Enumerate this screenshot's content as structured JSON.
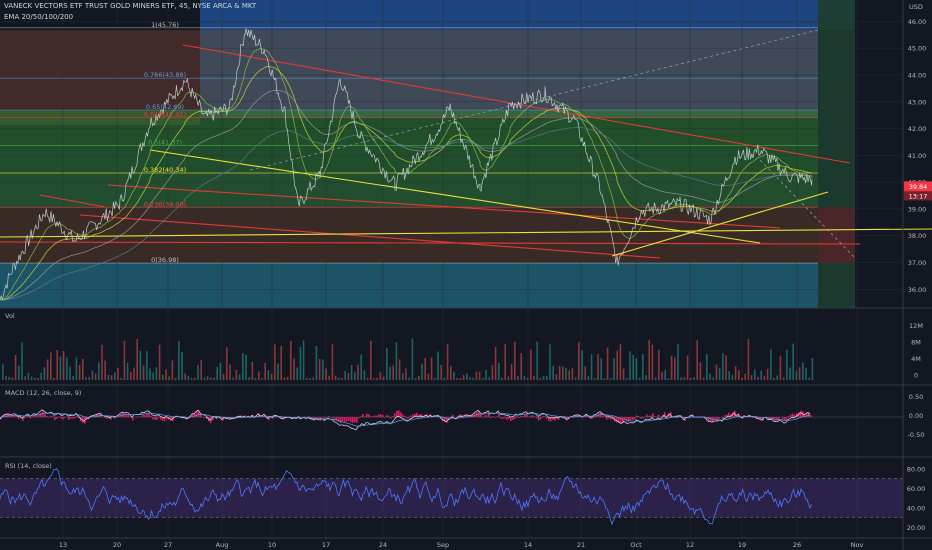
{
  "header": {
    "title": "VANECK VECTORS ETF TRUST GOLD MINERS ETF, 45, NYSE ARCA & MKT",
    "indicator": "EMA 20/50/100/200"
  },
  "panes": {
    "vol_label": "Vol",
    "macd_label": "MACD (12, 26, close, 9)",
    "rsi_label": "RSI (14, close)"
  },
  "price_scale": {
    "currency": "USD",
    "ticks": [
      "46.00",
      "45.00",
      "44.00",
      "43.00",
      "42.00",
      "41.00",
      "40.00",
      "39.00",
      "38.00",
      "37.00",
      "36.00"
    ],
    "last_price": "39.84",
    "countdown": "13:17",
    "last_color": "#f23645"
  },
  "vol_scale": {
    "ticks": [
      "12M",
      "8M",
      "4M",
      "0"
    ]
  },
  "macd_scale": {
    "ticks": [
      "0.50",
      "0.00",
      "-0.50"
    ]
  },
  "rsi_scale": {
    "ticks": [
      "80.00",
      "60.00",
      "40.00",
      "20.00"
    ]
  },
  "x_axis": {
    "ticks": [
      "13",
      "20",
      "27",
      "Aug",
      "10",
      "17",
      "24",
      "Sep",
      "14",
      "21",
      "Oct",
      "12",
      "19",
      "26",
      "Nov"
    ]
  },
  "fib_labels": [
    "1(45.76)",
    "0.786(43.88)",
    "0.65(42.69)",
    "0.618(42.41)",
    "0.5(41.37)",
    "0.382(40.34)",
    "0.236(39.06)",
    "0(36.98)"
  ],
  "colors": {
    "bg": "#131722",
    "up": "#4caf50",
    "down": "#f23645",
    "fib_green": "#2e7d32",
    "fib_blue": "#1565c0",
    "trend_yellow": "#e8e23a",
    "trend_red": "#e53935",
    "macd_line": "#2962ff",
    "signal": "#ff6d00",
    "hist": "#ff1f6a",
    "rsi": "#4e79ff"
  },
  "chart_data": {
    "type": "line",
    "title": "VANECK VECTORS ETF TRUST GOLD MINERS ETF, 45, NYSE ARCA & MKT",
    "x_ticks": [
      "13",
      "20",
      "27",
      "Aug",
      "10",
      "17",
      "24",
      "Sep",
      "14",
      "21",
      "Oct",
      "12",
      "19",
      "26",
      "Nov"
    ],
    "y_range": [
      35.3,
      46.5
    ],
    "price_path": [
      [
        0,
        35.6
      ],
      [
        13,
        36.8
      ],
      [
        45,
        38.9
      ],
      [
        75,
        37.8
      ],
      [
        120,
        39.2
      ],
      [
        150,
        42.2
      ],
      [
        185,
        43.8
      ],
      [
        205,
        42.4
      ],
      [
        230,
        42.8
      ],
      [
        245,
        45.7
      ],
      [
        265,
        44.9
      ],
      [
        285,
        42.6
      ],
      [
        298,
        39.1
      ],
      [
        320,
        40.3
      ],
      [
        340,
        43.9
      ],
      [
        360,
        41.7
      ],
      [
        395,
        39.9
      ],
      [
        435,
        41.8
      ],
      [
        450,
        42.8
      ],
      [
        480,
        39.8
      ],
      [
        510,
        42.9
      ],
      [
        545,
        43.3
      ],
      [
        575,
        42.3
      ],
      [
        600,
        39.8
      ],
      [
        617,
        37.0
      ],
      [
        640,
        38.9
      ],
      [
        680,
        39.2
      ],
      [
        710,
        38.6
      ],
      [
        735,
        40.9
      ],
      [
        760,
        41.2
      ],
      [
        790,
        40.2
      ],
      [
        812,
        40.1
      ]
    ],
    "last": 39.84,
    "series": [
      {
        "name": "Vol",
        "ticks": [
          "12M",
          "8M",
          "4M",
          "0"
        ],
        "range": [
          0,
          14
        ]
      },
      {
        "name": "MACD (12, 26, close, 9)",
        "ticks": [
          "0.50",
          "0.00",
          "-0.50"
        ],
        "range": [
          -0.8,
          0.8
        ]
      },
      {
        "name": "RSI (14, close)",
        "ticks": [
          "80.00",
          "60.00",
          "40.00",
          "20.00"
        ],
        "range": [
          10,
          90
        ],
        "bands": [
          70,
          30
        ]
      }
    ],
    "fibonacci": [
      45.76,
      43.88,
      42.69,
      42.41,
      41.37,
      40.34,
      39.06,
      36.98
    ]
  }
}
